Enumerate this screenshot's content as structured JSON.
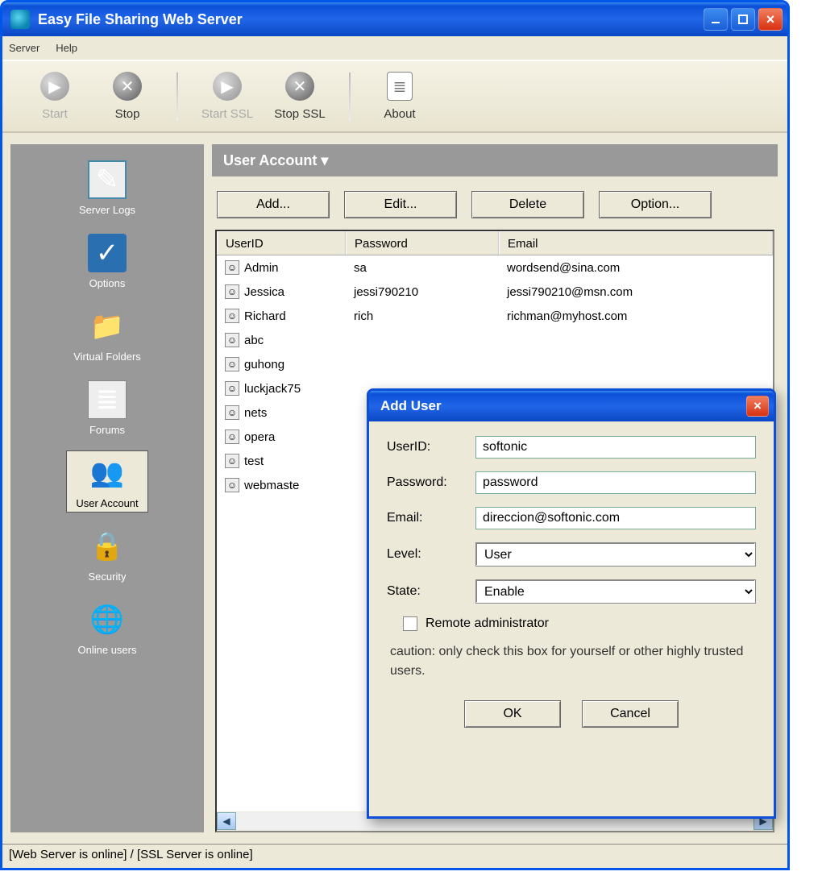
{
  "window": {
    "title": "Easy File Sharing Web Server"
  },
  "menu": {
    "server": "Server",
    "help": "Help"
  },
  "toolbar": {
    "start": "Start",
    "stop": "Stop",
    "startssl": "Start SSL",
    "stopssl": "Stop SSL",
    "about": "About"
  },
  "sidebar": {
    "items": [
      {
        "label": "Server Logs"
      },
      {
        "label": "Options"
      },
      {
        "label": "Virtual Folders"
      },
      {
        "label": "Forums"
      },
      {
        "label": "User Account"
      },
      {
        "label": "Security"
      },
      {
        "label": "Online users"
      }
    ]
  },
  "panel": {
    "heading": "User Account",
    "buttons": {
      "add": "Add...",
      "edit": "Edit...",
      "delete": "Delete",
      "option": "Option..."
    },
    "cols": {
      "userid": "UserID",
      "password": "Password",
      "email": "Email"
    },
    "rows": [
      {
        "userid": "Admin",
        "password": "sa",
        "email": "wordsend@sina.com"
      },
      {
        "userid": "Jessica",
        "password": "jessi790210",
        "email": "jessi790210@msn.com"
      },
      {
        "userid": "Richard",
        "password": "rich",
        "email": "richman@myhost.com"
      },
      {
        "userid": "abc",
        "password": "",
        "email": ""
      },
      {
        "userid": "guhong",
        "password": "",
        "email": ""
      },
      {
        "userid": "luckjack75",
        "password": "",
        "email": ""
      },
      {
        "userid": "nets",
        "password": "",
        "email": ""
      },
      {
        "userid": "opera",
        "password": "",
        "email": ""
      },
      {
        "userid": "test",
        "password": "",
        "email": ""
      },
      {
        "userid": "webmaste",
        "password": "",
        "email": ""
      }
    ]
  },
  "dialog": {
    "title": "Add User",
    "labels": {
      "userid": "UserID:",
      "password": "Password:",
      "email": "Email:",
      "level": "Level:",
      "state": "State:"
    },
    "values": {
      "userid": "softonic",
      "password": "password",
      "email": "direccion@softonic.com",
      "level": "User",
      "state": "Enable"
    },
    "remote_label": "Remote administrator",
    "remote_checked": false,
    "caution": "caution: only check this box for yourself or other highly trusted users.",
    "ok": "OK",
    "cancel": "Cancel"
  },
  "status": "[Web Server is online] / [SSL Server is online]"
}
